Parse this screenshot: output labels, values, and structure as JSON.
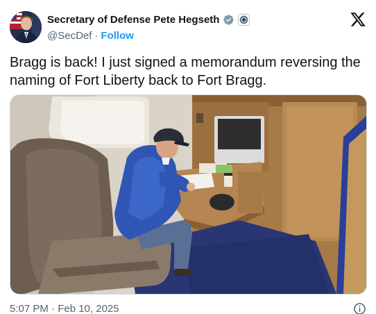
{
  "author": {
    "display_name": "Secretary of Defense Pete Hegseth",
    "handle": "@SecDef",
    "separator": "·",
    "follow_label": "Follow",
    "verified_badge_icon": "gray-verified-checkmark-icon",
    "affiliate_badge_icon": "department-of-defense-seal-icon"
  },
  "platform_logo_icon": "x-logo-icon",
  "tweet": {
    "text": "Bragg is back! I just signed a memorandum reversing the naming of Fort Liberty back to Fort Bragg."
  },
  "media": {
    "type": "photo",
    "description_icon": "media-photo"
  },
  "footer": {
    "timestamp": "5:07 PM · Feb 10, 2025",
    "info_icon": "info-circle-icon"
  },
  "colors": {
    "text_primary": "#0f1419",
    "text_secondary": "#536471",
    "link_blue": "#1d9bf0",
    "border": "#cfd9de",
    "verified_gray": "#829aab"
  }
}
